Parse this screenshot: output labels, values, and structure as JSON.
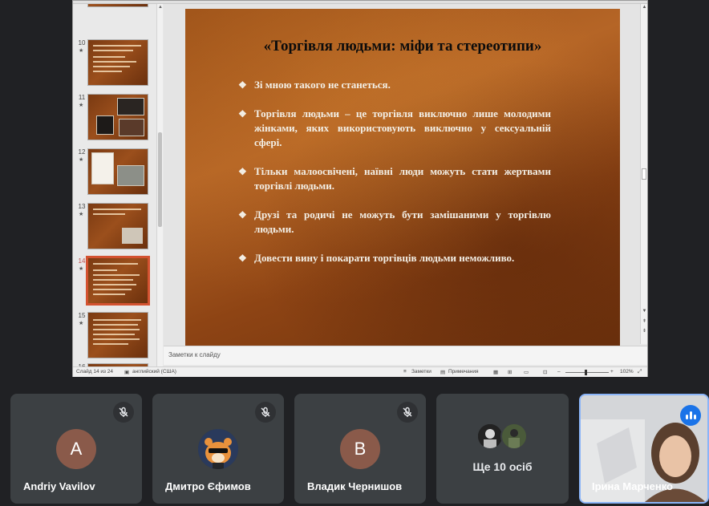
{
  "presentation": {
    "slide_title": "«Торгівля людьми: міфи та стереотипи»",
    "bullets": [
      "Зі мною такого не станеться.",
      "Торгівля людьми – це торгівля виключно лише молодими жінками, яких використовують виключно у сексуальній сфері.",
      "Тільки малоосвічені, наївні люди можуть стати жертвами торгівлі людьми.",
      "Друзі та родичі не можуть бути замішаними у торгівлю людьми.",
      "Довести вину і покарати торгівців людьми неможливо."
    ],
    "thumbnails": [
      "10",
      "11",
      "12",
      "13",
      "14",
      "15",
      "16"
    ],
    "active_slide": "14",
    "notes_placeholder": "Заметки к слайду",
    "status": {
      "slide_counter": "Слайд 14 из 24",
      "language": "английский (США)",
      "notes_button": "Заметки",
      "comments_button": "Примечания",
      "zoom_minus": "–",
      "zoom_plus": "+",
      "zoom": "102%"
    }
  },
  "participants": [
    {
      "name": "Andriy Vavilov",
      "initial": "A",
      "avatar_color": "#8a5a4a",
      "muted": true
    },
    {
      "name": "Дмитро Єфимов",
      "avatar_icon": "hamster-avatar-icon",
      "muted": true
    },
    {
      "name": "Владик Чернишов",
      "initial": "В",
      "avatar_color": "#8a5a4a",
      "muted": true
    },
    {
      "more_label": "Ще 10 осіб"
    },
    {
      "name": "Ірина Марченко",
      "speaking": true
    }
  ],
  "colors": {
    "accent": "#8ab4f8",
    "speaking": "#1a73e8",
    "tile_bg": "#3c4043",
    "page_bg": "#202124"
  }
}
